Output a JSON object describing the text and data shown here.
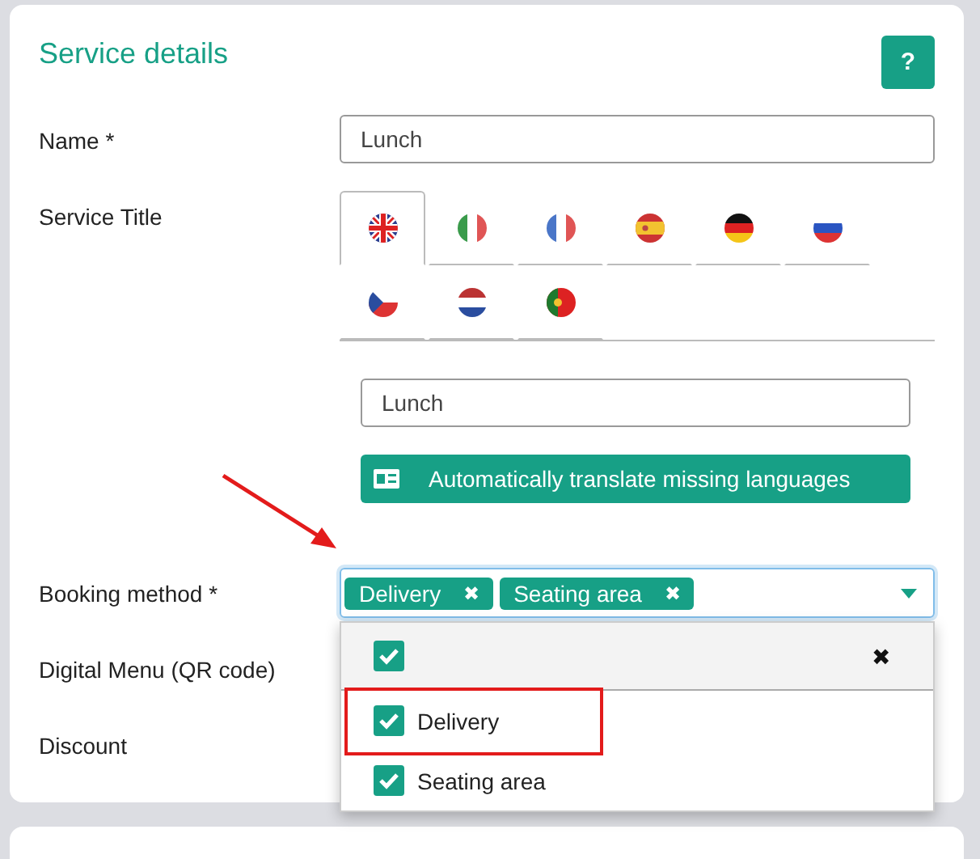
{
  "card": {
    "title": "Service details",
    "help_button": "?"
  },
  "name_field": {
    "label": "Name *",
    "value": "Lunch"
  },
  "service_title": {
    "label": "Service Title",
    "languages": [
      {
        "kind": "gb",
        "selected": true
      },
      {
        "kind": "it",
        "selected": false
      },
      {
        "kind": "fr",
        "selected": false
      },
      {
        "kind": "es",
        "selected": false
      },
      {
        "kind": "de",
        "selected": false
      },
      {
        "kind": "ru",
        "selected": false
      },
      {
        "kind": "cz",
        "selected": false
      },
      {
        "kind": "nl",
        "selected": false
      },
      {
        "kind": "pt",
        "selected": false
      }
    ],
    "value": "Lunch",
    "translate_button": "Automatically translate missing languages"
  },
  "booking_method": {
    "label": "Booking method *",
    "tags": [
      {
        "label": "Delivery",
        "remove": "✖"
      },
      {
        "label": "Seating area",
        "remove": "✖"
      }
    ],
    "dropdown": {
      "select_all_checked": true,
      "clear": "✖",
      "options": [
        {
          "label": "Delivery",
          "checked": true,
          "highlighted": true
        },
        {
          "label": "Seating area",
          "checked": true,
          "highlighted": false
        }
      ]
    }
  },
  "digital_menu": {
    "label": "Digital Menu (QR code)"
  },
  "discount": {
    "label": "Discount"
  }
}
